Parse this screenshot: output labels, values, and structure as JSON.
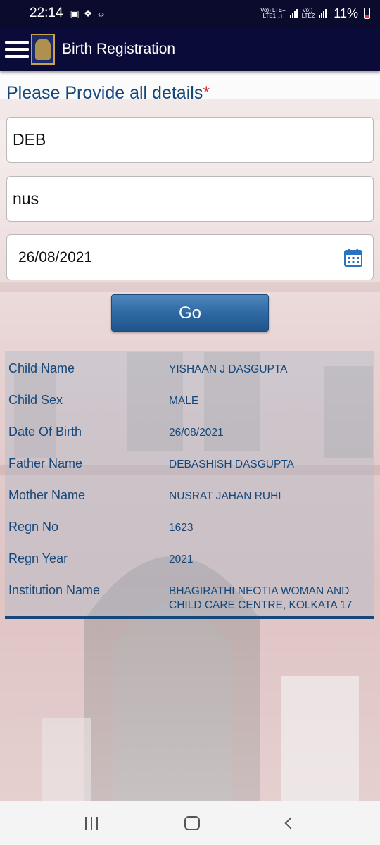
{
  "status_bar": {
    "time": "22:14",
    "network_1": "Vo)) LTE+\nLTE1 ↓↑",
    "network_2": "Vo)) \nLTE2",
    "battery": "11%"
  },
  "app_bar": {
    "title": "Birth Registration",
    "menu_icon": "hamburger-menu-icon",
    "logo_icon": "emblem-logo"
  },
  "form": {
    "heading": "Please Provide all details",
    "required_mark": "*",
    "field_1_value": "DEB",
    "field_2_value": "nus",
    "date_value": "26/08/2021",
    "go_label": "Go"
  },
  "details": {
    "rows": [
      {
        "label": "Child Name",
        "value": "YISHAAN J DASGUPTA"
      },
      {
        "label": "Child Sex",
        "value": "MALE"
      },
      {
        "label": "Date Of Birth",
        "value": "26/08/2021"
      },
      {
        "label": "Father Name",
        "value": "DEBASHISH DASGUPTA"
      },
      {
        "label": "Mother Name",
        "value": "NUSRAT JAHAN RUHI"
      },
      {
        "label": "Regn No",
        "value": "1623"
      },
      {
        "label": "Regn Year",
        "value": "2021"
      },
      {
        "label": "Institution Name",
        "value": "BHAGIRATHI NEOTIA WOMAN AND CHILD CARE CENTRE, KOLKATA 17"
      }
    ]
  },
  "colors": {
    "app_bar": "#0b0b3a",
    "heading_text": "#15477a",
    "required": "#d32f2f",
    "button": "#2f69a3"
  }
}
